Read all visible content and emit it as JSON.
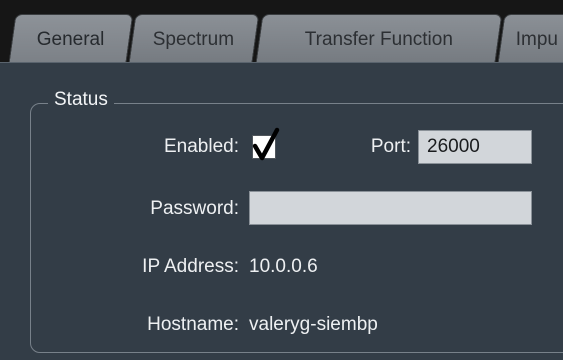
{
  "tabs": [
    {
      "label": "General",
      "active": true
    },
    {
      "label": "Spectrum",
      "active": false
    },
    {
      "label": "Transfer Function",
      "active": false
    },
    {
      "label": "Impu",
      "active": false
    }
  ],
  "status_group": {
    "title": "Status",
    "enabled_label": "Enabled:",
    "enabled_checked": true,
    "port_label": "Port:",
    "port_value": "26000",
    "password_label": "Password:",
    "password_value": "",
    "ip_label": "IP Address:",
    "ip_value": "10.0.0.6",
    "hostname_label": "Hostname:",
    "hostname_value": "valeryg-siembp"
  },
  "colors": {
    "panel_background": "#333d47",
    "tab_background": "#808589",
    "field_background": "#d2d6da"
  },
  "icons": {
    "enabled_check": "checkmark-icon"
  }
}
